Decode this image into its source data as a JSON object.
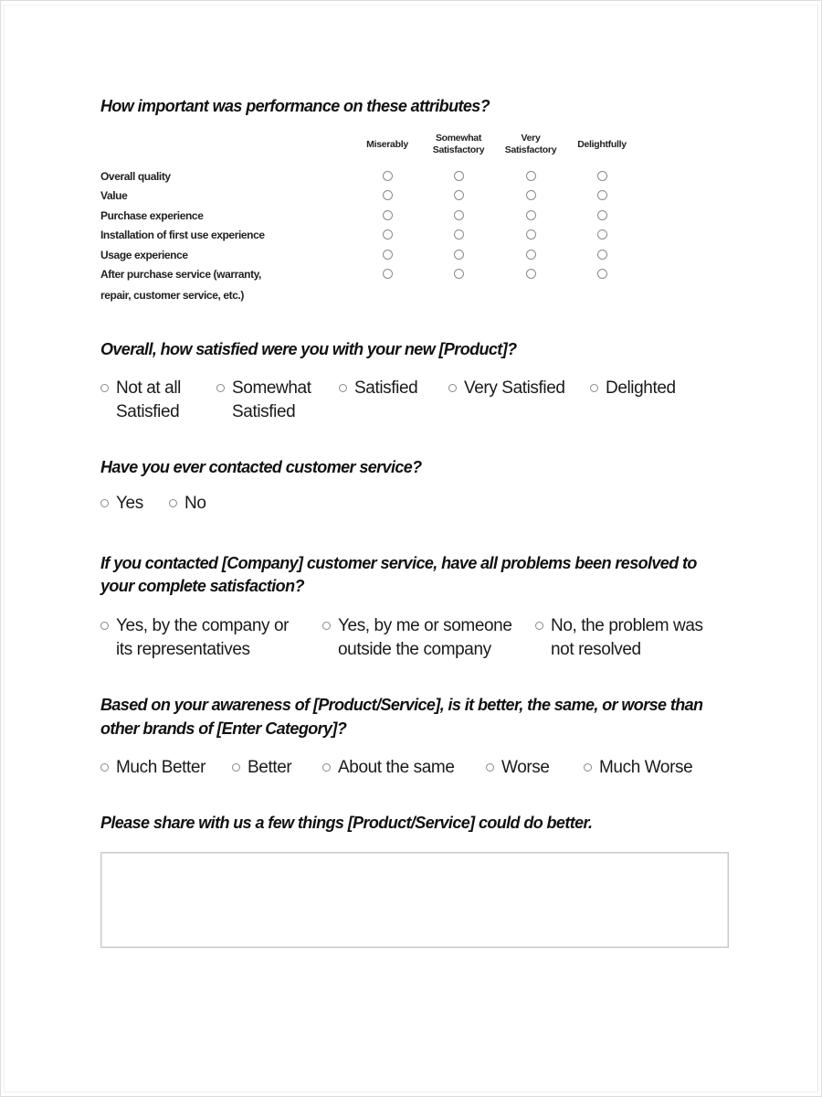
{
  "matrix": {
    "question": "How important was performance on these attributes?",
    "columns": [
      "Miserably",
      "Somewhat\nSatisfactory",
      "Very\nSatisfactory",
      "Delightfully"
    ],
    "rows": [
      "Overall quality",
      "Value",
      "Purchase experience",
      "Installation of first use experience",
      "Usage experience",
      "After purchase service (warranty,",
      "repair, customer service, etc.)"
    ],
    "row_labels": [
      "Overall quality",
      "Value",
      "Purchase experience",
      "Installation of first use experience",
      "Usage experience",
      "After purchase service (warranty, repair, customer service, etc.)"
    ]
  },
  "satisfaction": {
    "question": "Overall, how satisfied were you with your new [Product]?",
    "options": [
      "Not at all\nSatisfied",
      "Somewhat\nSatisfied",
      "Satisfied",
      "Very Satisfied",
      "Delighted"
    ]
  },
  "contacted": {
    "question": "Have you ever contacted customer service?",
    "options": [
      "Yes",
      "No"
    ]
  },
  "resolved": {
    "question_line1": "If you contacted [Company] customer service, have all problems been resolved to",
    "question_line2": "your complete satisfaction?",
    "options": [
      "Yes, by the company or\nits representatives",
      "Yes, by me or someone\noutside the company",
      "No, the problem was\nnot resolved"
    ]
  },
  "comparison": {
    "question_line1": "Based on your awareness of [Product/Service], is it better, the same, or worse than",
    "question_line2": "other brands of [Enter Category]?",
    "options": [
      "Much Better",
      "Better",
      "About the same",
      "Worse",
      "Much Worse"
    ]
  },
  "feedback": {
    "question": "Please share with us a few things [Product/Service] could do better.",
    "value": ""
  }
}
